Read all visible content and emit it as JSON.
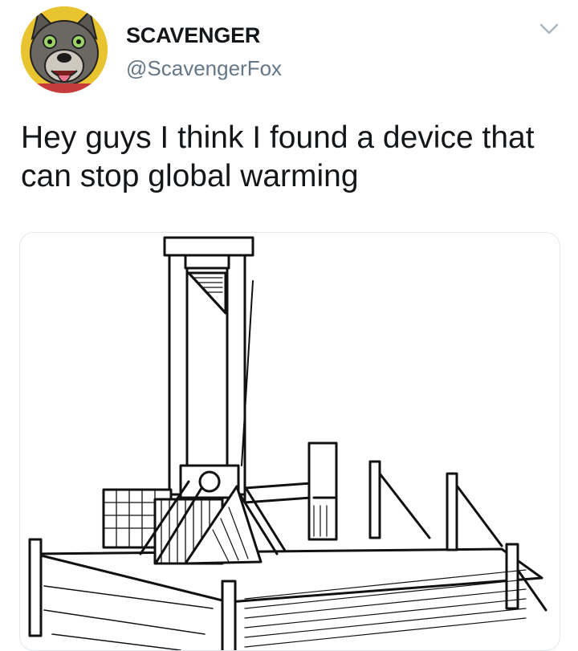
{
  "tweet": {
    "author": {
      "display_name": "SCAVENGER",
      "handle": "@ScavengerFox",
      "avatar_icon": "wolf-avatar-icon"
    },
    "menu_icon": "chevron-down-icon",
    "text": "Hey guys I think I found a device that can stop global warming",
    "media": {
      "kind": "illustration",
      "icon": "guillotine-illustration"
    }
  },
  "colors": {
    "text_primary": "#14171a",
    "text_secondary": "#657786",
    "border": "#e1e8ed",
    "caret": "#aab8c2",
    "avatar_bg": "#e8c431"
  }
}
